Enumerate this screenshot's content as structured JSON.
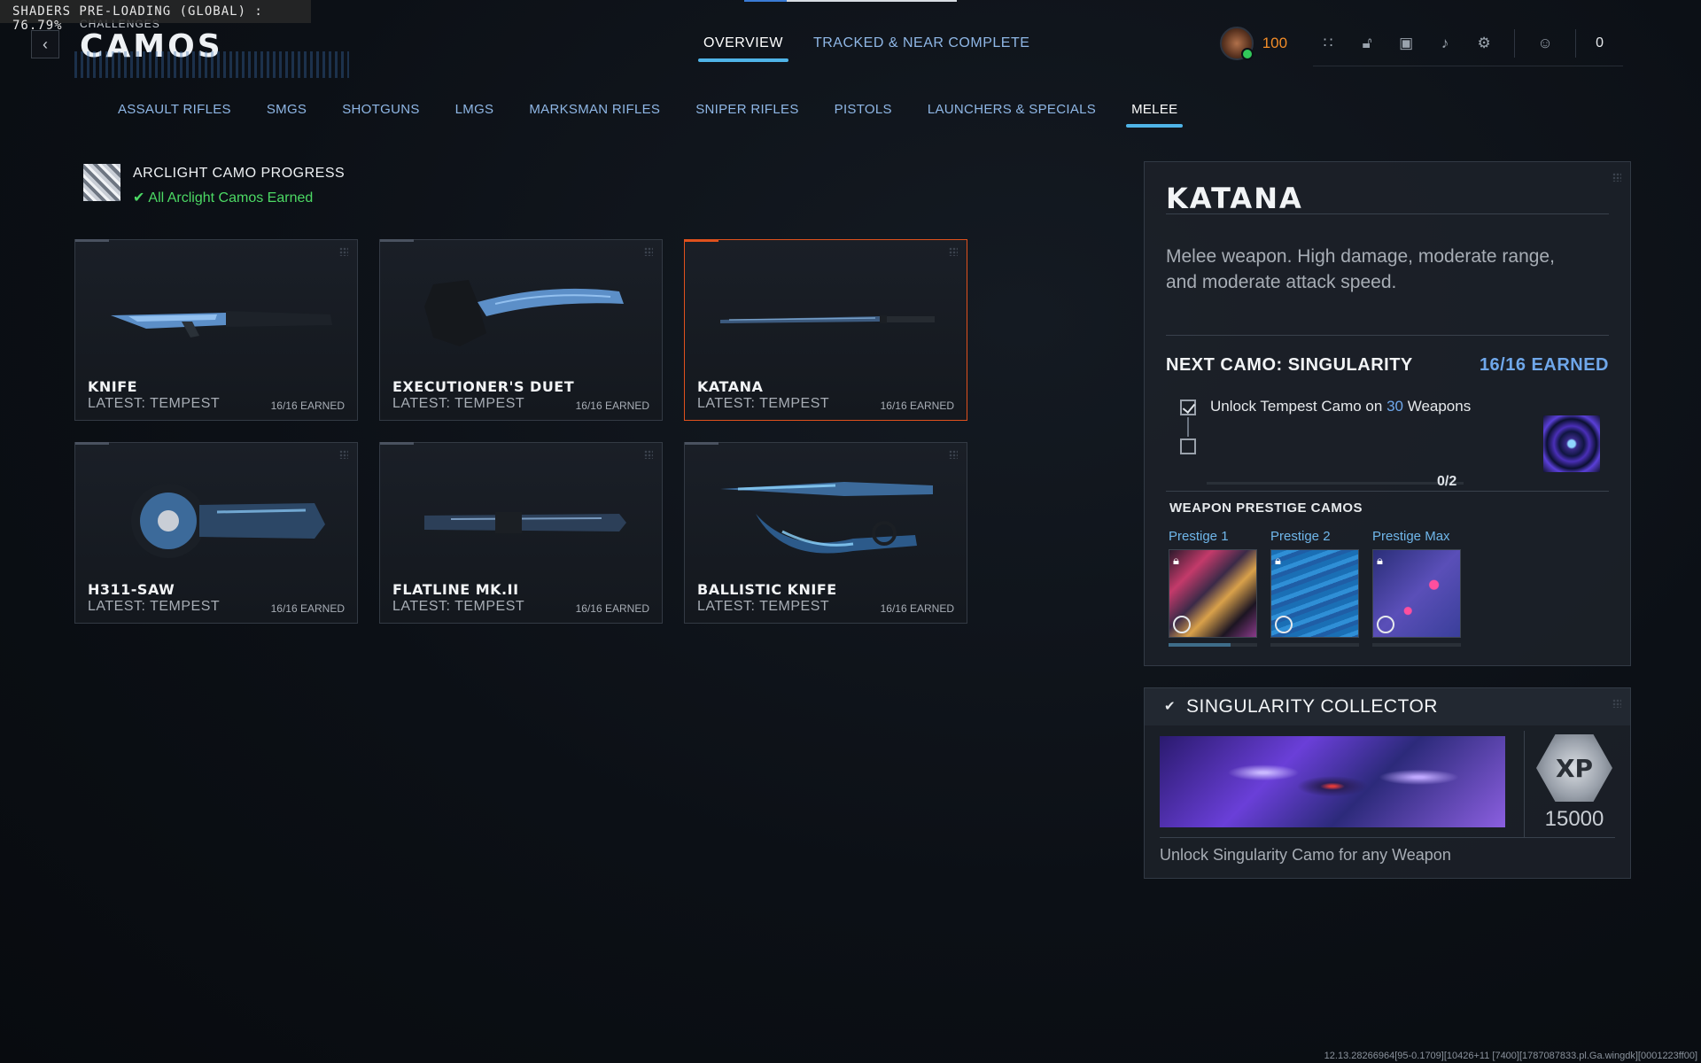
{
  "overlay": {
    "shader_text": "SHADERS PRE-LOADING (GLOBAL) : 76.79%"
  },
  "header": {
    "back_icon": "chevron-left-icon",
    "breadcrumb": "CHALLENGES",
    "title": "CAMOS",
    "tabs": [
      {
        "label": "OVERVIEW",
        "active": true
      },
      {
        "label": "TRACKED & NEAR COMPLETE",
        "active": false
      }
    ]
  },
  "hud": {
    "rank_level": "100",
    "icons": [
      "grid-dots-icon",
      "unlock-icon",
      "store-icon",
      "bell-icon",
      "gear-icon"
    ],
    "social_icon": "party-icon",
    "social_count": "0"
  },
  "categories": [
    {
      "label": "ASSAULT RIFLES",
      "active": false
    },
    {
      "label": "SMGS",
      "active": false
    },
    {
      "label": "SHOTGUNS",
      "active": false
    },
    {
      "label": "LMGS",
      "active": false
    },
    {
      "label": "MARKSMAN RIFLES",
      "active": false
    },
    {
      "label": "SNIPER RIFLES",
      "active": false
    },
    {
      "label": "PISTOLS",
      "active": false
    },
    {
      "label": "LAUNCHERS & SPECIALS",
      "active": false
    },
    {
      "label": "MELEE",
      "active": true
    }
  ],
  "arclight": {
    "title": "ARCLIGHT CAMO PROGRESS",
    "status": "All Arclight Camos Earned"
  },
  "weapons": [
    {
      "name": "KNIFE",
      "latest": "LATEST: TEMPEST",
      "earned": "16/16 EARNED",
      "selected": false
    },
    {
      "name": "EXECUTIONER'S DUET",
      "latest": "LATEST: TEMPEST",
      "earned": "16/16 EARNED",
      "selected": false
    },
    {
      "name": "KATANA",
      "latest": "LATEST: TEMPEST",
      "earned": "16/16 EARNED",
      "selected": true
    },
    {
      "name": "H311-SAW",
      "latest": "LATEST: TEMPEST",
      "earned": "16/16 EARNED",
      "selected": false
    },
    {
      "name": "FLATLINE MK.II",
      "latest": "LATEST: TEMPEST",
      "earned": "16/16 EARNED",
      "selected": false
    },
    {
      "name": "BALLISTIC KNIFE",
      "latest": "LATEST: TEMPEST",
      "earned": "16/16 EARNED",
      "selected": false
    }
  ],
  "detail": {
    "weapon_name": "KATANA",
    "description": "Melee weapon. High damage, moderate range, and moderate attack speed.",
    "next_camo_label": "NEXT CAMO: SINGULARITY",
    "next_camo_earned": "16/16 EARNED",
    "requirement_prefix": "Unlock Tempest Camo on ",
    "requirement_count": "30",
    "requirement_suffix": " Weapons",
    "progress_text": "0/2",
    "prestige_heading": "WEAPON PRESTIGE CAMOS",
    "prestige": [
      {
        "label": "Prestige 1",
        "progress": 0.7
      },
      {
        "label": "Prestige 2",
        "progress": 0
      },
      {
        "label": "Prestige Max",
        "progress": 0
      }
    ]
  },
  "collector": {
    "title": "SINGULARITY COLLECTOR",
    "xp_label": "XP",
    "xp_amount": "15000",
    "description": "Unlock Singularity Camo for any Weapon"
  },
  "build_info": "12.13.28266964[95-0.1709][10426+11 [7400][1787087833.pl.Ga.wingdk][0001223ff00]"
}
